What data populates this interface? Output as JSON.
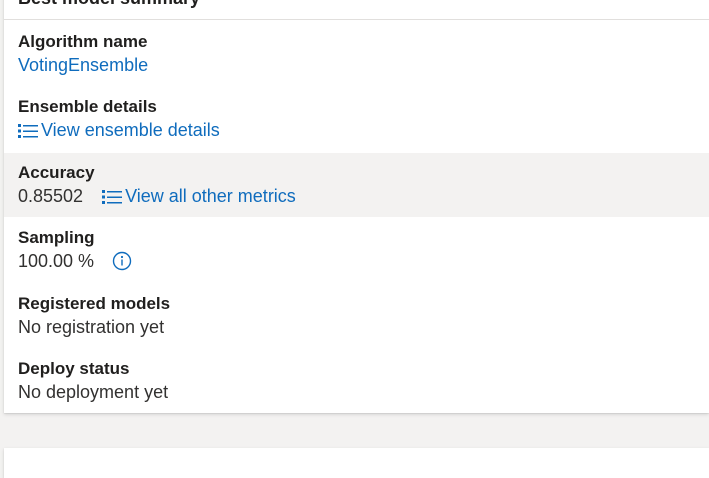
{
  "card": {
    "title": "Best model summary"
  },
  "fields": {
    "algorithm": {
      "label": "Algorithm name",
      "value": "VotingEnsemble"
    },
    "ensemble": {
      "label": "Ensemble details",
      "link": "View ensemble details",
      "icon": "list-icon"
    },
    "accuracy": {
      "label": "Accuracy",
      "value": "0.85502",
      "link": "View all other metrics",
      "icon": "list-icon"
    },
    "sampling": {
      "label": "Sampling",
      "value": "100.00 %",
      "icon": "info-icon"
    },
    "registered": {
      "label": "Registered models",
      "value": "No registration yet"
    },
    "deploy": {
      "label": "Deploy status",
      "value": "No deployment yet"
    }
  },
  "colors": {
    "link": "#0f6cbd",
    "highlight_row": "#f3f2f1",
    "border": "#e1dfdd"
  }
}
